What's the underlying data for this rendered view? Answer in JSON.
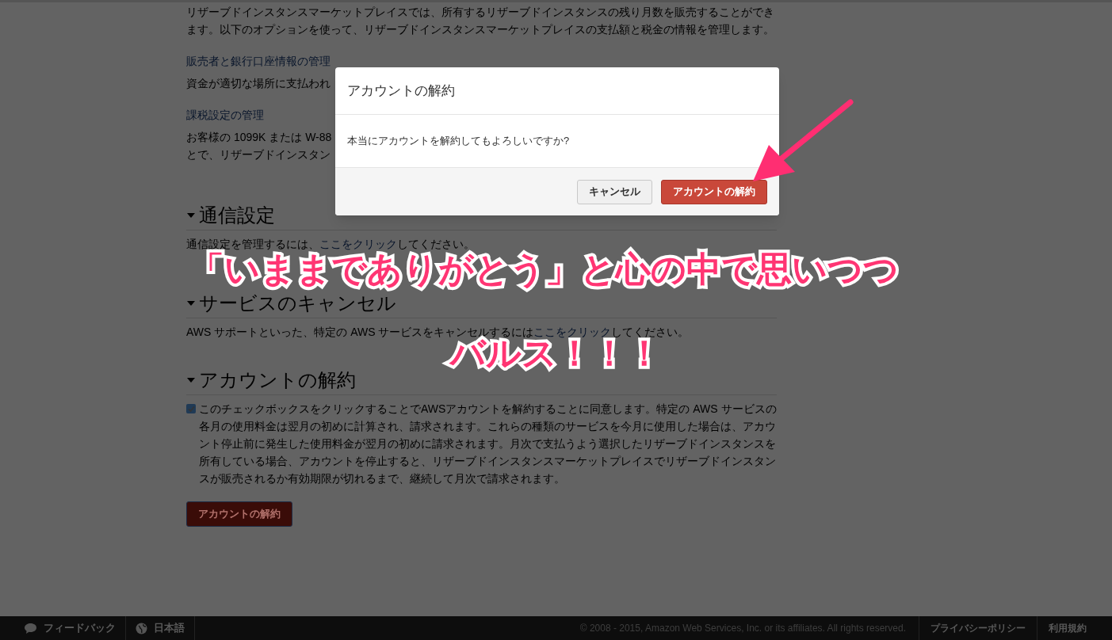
{
  "page": {
    "intro": "リザーブドインスタンスマーケットプレイスでは、所有するリザーブドインスタンスの残り月数を販売することができます。以下のオプションを使って、リザーブドインスタンスマーケットプレイスの支払額と税金の情報を管理します。",
    "reserved_links": [
      {
        "link": "販売者と銀行口座情報の管理",
        "lines": [
          "資金が適切な場所に支払われ"
        ]
      },
      {
        "link": "課税設定の管理",
        "lines": [
          "お客様の 1099K または W-88",
          "とで、リザーブドインスタン"
        ]
      }
    ],
    "sections": [
      {
        "kind": "link",
        "title": "通信設定",
        "expanded": true,
        "text_before": "通信設定を管理するには、",
        "link": "ここをクリック",
        "text_after": "してください。"
      },
      {
        "kind": "link",
        "title": "サービスのキャンセル",
        "expanded": true,
        "text_before": "AWS サポートといった、特定の AWS サービスをキャンセルするには",
        "link": "ここをクリック",
        "text_after": "してください。"
      },
      {
        "kind": "agreement",
        "title": "アカウントの解約",
        "expanded": true,
        "checked": true,
        "text": "このチェックボックスをクリックすることでAWSアカウントを解約することに同意します。特定の AWS サービスの各月の使用料金は翌月の初めに計算され、請求されます。これらの種類のサービスを今月に使用した場合は、アカウント停止前に発生した使用料金が翌月の初めに請求されます。月次で支払うよう選択したリザーブドインスタンスを所有している場合、アカウントを停止すると、リザーブドインスタンスマーケットプレイスでリザーブドインスタンスが販売されるか有効期限が切れるまで、継続して月次で請求されます。",
        "button": "アカウントの解約"
      }
    ]
  },
  "dialog": {
    "title": "アカウントの解約",
    "message": "本当にアカウントを解約してもよろしいですか?",
    "buttons": [
      {
        "label": "キャンセル",
        "kind": "default"
      },
      {
        "label": "アカウントの解約",
        "kind": "danger"
      }
    ]
  },
  "annotation": {
    "lines": [
      "「いままでありがとう」と心の中で思いつつ",
      "バルス！！！"
    ]
  },
  "footer": {
    "items": [
      {
        "kind": "feedback",
        "label": "フィードバック"
      },
      {
        "kind": "language",
        "label": "日本語"
      }
    ],
    "copyright": "© 2008 - 2015, Amazon Web Services, Inc. or its affiliates. All rights reserved.",
    "links": [
      "プライバシーポリシー",
      "利用規約"
    ]
  }
}
